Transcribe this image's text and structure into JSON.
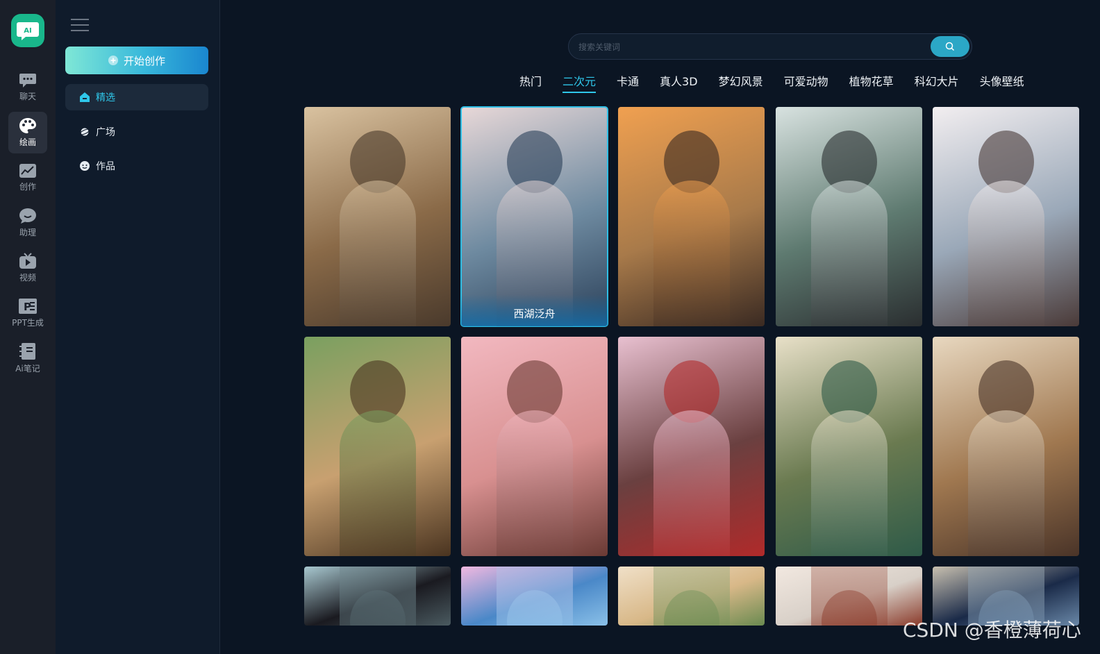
{
  "app": {
    "logo_text": "AI"
  },
  "rail": {
    "items": [
      {
        "label": "聊天",
        "icon": "chat-icon"
      },
      {
        "label": "绘画",
        "icon": "palette-icon",
        "active": true
      },
      {
        "label": "创作",
        "icon": "chart-icon"
      },
      {
        "label": "助理",
        "icon": "assistant-icon"
      },
      {
        "label": "视频",
        "icon": "tv-icon"
      },
      {
        "label": "PPT生成",
        "icon": "ppt-icon"
      },
      {
        "label": "Ai笔记",
        "icon": "notebook-icon"
      }
    ]
  },
  "sidebar": {
    "create_label": "开始创作",
    "nav": [
      {
        "label": "精选",
        "icon": "home-icon",
        "active": true
      },
      {
        "label": "广场",
        "icon": "planet-icon"
      },
      {
        "label": "作品",
        "icon": "smile-icon"
      }
    ]
  },
  "search": {
    "placeholder": "搜索关键词"
  },
  "tabs": [
    {
      "label": "热门"
    },
    {
      "label": "二次元",
      "active": true
    },
    {
      "label": "卡通"
    },
    {
      "label": "真人3D"
    },
    {
      "label": "梦幻风景"
    },
    {
      "label": "可爱动物"
    },
    {
      "label": "植物花草"
    },
    {
      "label": "科幻大片"
    },
    {
      "label": "头像壁纸"
    }
  ],
  "gallery": {
    "hover_caption": "西湖泛舟",
    "colors": [
      [
        "#8a6a48",
        "#d9c2a0",
        "#4a3a2c"
      ],
      [
        "#6e8aa0",
        "#e8d8d8",
        "#2a3f58"
      ],
      [
        "#a87a4a",
        "#f0a050",
        "#3a2a22"
      ],
      [
        "#5e7a70",
        "#d8e2e0",
        "#2a2e30"
      ],
      [
        "#9aa8b8",
        "#f2eef0",
        "#4a3a38"
      ],
      [
        "#c8a070",
        "#7aa060",
        "#4a3420"
      ],
      [
        "#d89090",
        "#f2b8c0",
        "#6a3a34"
      ],
      [
        "#6a4040",
        "#e8c0d0",
        "#b02a2a"
      ],
      [
        "#6a7a50",
        "#e8e0c8",
        "#2e5a48"
      ],
      [
        "#a07850",
        "#e8d8c0",
        "#4a3428"
      ],
      [
        "#1a1a20",
        "#a8c8d0",
        "#4a5a60"
      ],
      [
        "#4a88c8",
        "#f0b8e0",
        "#8ac0e8"
      ],
      [
        "#d8b888",
        "#f0e0c8",
        "#6a8a50"
      ],
      [
        "#d8d0c8",
        "#f2e8e0",
        "#8a3a2a"
      ],
      [
        "#1a2a48",
        "#c8c0b0",
        "#6a88a8"
      ]
    ]
  },
  "watermark": "CSDN @香橙薄荷心"
}
